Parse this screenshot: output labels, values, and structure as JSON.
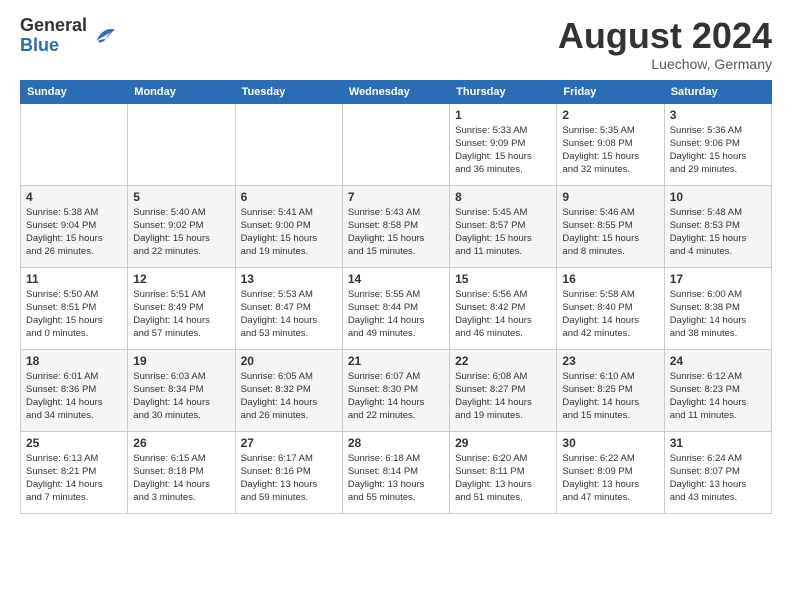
{
  "header": {
    "logo_general": "General",
    "logo_blue": "Blue",
    "month_title": "August 2024",
    "location": "Luechow, Germany"
  },
  "weekdays": [
    "Sunday",
    "Monday",
    "Tuesday",
    "Wednesday",
    "Thursday",
    "Friday",
    "Saturday"
  ],
  "weeks": [
    [
      {
        "day": "",
        "info": ""
      },
      {
        "day": "",
        "info": ""
      },
      {
        "day": "",
        "info": ""
      },
      {
        "day": "",
        "info": ""
      },
      {
        "day": "1",
        "info": "Sunrise: 5:33 AM\nSunset: 9:09 PM\nDaylight: 15 hours\nand 36 minutes."
      },
      {
        "day": "2",
        "info": "Sunrise: 5:35 AM\nSunset: 9:08 PM\nDaylight: 15 hours\nand 32 minutes."
      },
      {
        "day": "3",
        "info": "Sunrise: 5:36 AM\nSunset: 9:06 PM\nDaylight: 15 hours\nand 29 minutes."
      }
    ],
    [
      {
        "day": "4",
        "info": "Sunrise: 5:38 AM\nSunset: 9:04 PM\nDaylight: 15 hours\nand 26 minutes."
      },
      {
        "day": "5",
        "info": "Sunrise: 5:40 AM\nSunset: 9:02 PM\nDaylight: 15 hours\nand 22 minutes."
      },
      {
        "day": "6",
        "info": "Sunrise: 5:41 AM\nSunset: 9:00 PM\nDaylight: 15 hours\nand 19 minutes."
      },
      {
        "day": "7",
        "info": "Sunrise: 5:43 AM\nSunset: 8:58 PM\nDaylight: 15 hours\nand 15 minutes."
      },
      {
        "day": "8",
        "info": "Sunrise: 5:45 AM\nSunset: 8:57 PM\nDaylight: 15 hours\nand 11 minutes."
      },
      {
        "day": "9",
        "info": "Sunrise: 5:46 AM\nSunset: 8:55 PM\nDaylight: 15 hours\nand 8 minutes."
      },
      {
        "day": "10",
        "info": "Sunrise: 5:48 AM\nSunset: 8:53 PM\nDaylight: 15 hours\nand 4 minutes."
      }
    ],
    [
      {
        "day": "11",
        "info": "Sunrise: 5:50 AM\nSunset: 8:51 PM\nDaylight: 15 hours\nand 0 minutes."
      },
      {
        "day": "12",
        "info": "Sunrise: 5:51 AM\nSunset: 8:49 PM\nDaylight: 14 hours\nand 57 minutes."
      },
      {
        "day": "13",
        "info": "Sunrise: 5:53 AM\nSunset: 8:47 PM\nDaylight: 14 hours\nand 53 minutes."
      },
      {
        "day": "14",
        "info": "Sunrise: 5:55 AM\nSunset: 8:44 PM\nDaylight: 14 hours\nand 49 minutes."
      },
      {
        "day": "15",
        "info": "Sunrise: 5:56 AM\nSunset: 8:42 PM\nDaylight: 14 hours\nand 46 minutes."
      },
      {
        "day": "16",
        "info": "Sunrise: 5:58 AM\nSunset: 8:40 PM\nDaylight: 14 hours\nand 42 minutes."
      },
      {
        "day": "17",
        "info": "Sunrise: 6:00 AM\nSunset: 8:38 PM\nDaylight: 14 hours\nand 38 minutes."
      }
    ],
    [
      {
        "day": "18",
        "info": "Sunrise: 6:01 AM\nSunset: 8:36 PM\nDaylight: 14 hours\nand 34 minutes."
      },
      {
        "day": "19",
        "info": "Sunrise: 6:03 AM\nSunset: 8:34 PM\nDaylight: 14 hours\nand 30 minutes."
      },
      {
        "day": "20",
        "info": "Sunrise: 6:05 AM\nSunset: 8:32 PM\nDaylight: 14 hours\nand 26 minutes."
      },
      {
        "day": "21",
        "info": "Sunrise: 6:07 AM\nSunset: 8:30 PM\nDaylight: 14 hours\nand 22 minutes."
      },
      {
        "day": "22",
        "info": "Sunrise: 6:08 AM\nSunset: 8:27 PM\nDaylight: 14 hours\nand 19 minutes."
      },
      {
        "day": "23",
        "info": "Sunrise: 6:10 AM\nSunset: 8:25 PM\nDaylight: 14 hours\nand 15 minutes."
      },
      {
        "day": "24",
        "info": "Sunrise: 6:12 AM\nSunset: 8:23 PM\nDaylight: 14 hours\nand 11 minutes."
      }
    ],
    [
      {
        "day": "25",
        "info": "Sunrise: 6:13 AM\nSunset: 8:21 PM\nDaylight: 14 hours\nand 7 minutes."
      },
      {
        "day": "26",
        "info": "Sunrise: 6:15 AM\nSunset: 8:18 PM\nDaylight: 14 hours\nand 3 minutes."
      },
      {
        "day": "27",
        "info": "Sunrise: 6:17 AM\nSunset: 8:16 PM\nDaylight: 13 hours\nand 59 minutes."
      },
      {
        "day": "28",
        "info": "Sunrise: 6:18 AM\nSunset: 8:14 PM\nDaylight: 13 hours\nand 55 minutes."
      },
      {
        "day": "29",
        "info": "Sunrise: 6:20 AM\nSunset: 8:11 PM\nDaylight: 13 hours\nand 51 minutes."
      },
      {
        "day": "30",
        "info": "Sunrise: 6:22 AM\nSunset: 8:09 PM\nDaylight: 13 hours\nand 47 minutes."
      },
      {
        "day": "31",
        "info": "Sunrise: 6:24 AM\nSunset: 8:07 PM\nDaylight: 13 hours\nand 43 minutes."
      }
    ]
  ]
}
